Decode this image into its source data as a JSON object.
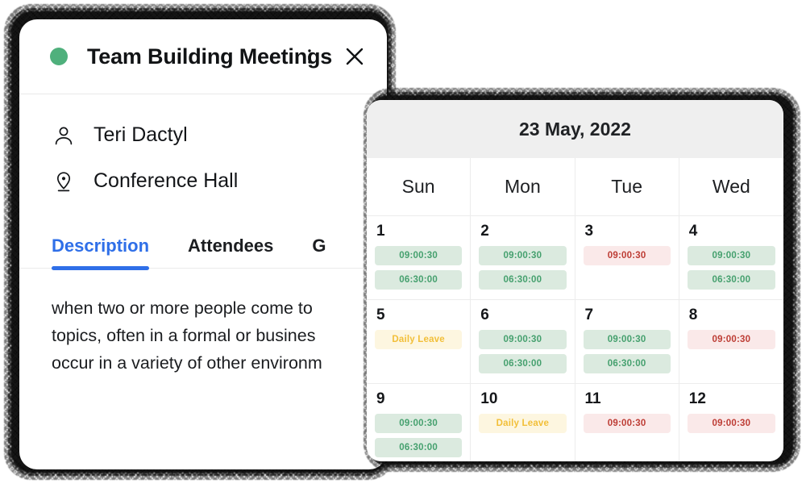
{
  "card": {
    "status_dot_color": "#4fb07c",
    "title": "Team Building Meetings",
    "menu_icon": "more-vertical-icon",
    "close_icon": "close-icon",
    "meta": [
      {
        "icon": "person-icon",
        "text": "Teri Dactyl"
      },
      {
        "icon": "location-pin-icon",
        "text": "Conference Hall"
      }
    ],
    "tabs": [
      {
        "label": "Description",
        "active": true
      },
      {
        "label": "Attendees",
        "active": false
      },
      {
        "label": "G",
        "active": false
      }
    ],
    "active_tab_color": "#2f6fe8",
    "description_lines": [
      "when two or more people come to",
      "topics, often in a formal or busines",
      "occur in a variety of other environm"
    ]
  },
  "calendar": {
    "title": "23 May, 2022",
    "header_bg": "#efefef",
    "weekdays": [
      "Sun",
      "Mon",
      "Tue",
      "Wed"
    ],
    "colors": {
      "green_bg": "#dbeadf",
      "green_text": "#45a06e",
      "red_bg": "#fae9e9",
      "red_text": "#bd3c34",
      "amber_bg": "#fdf6e0",
      "amber_text": "#f2bf38"
    },
    "days": [
      {
        "day": "1",
        "events": [
          {
            "label": "09:00:30",
            "tone": "green"
          },
          {
            "label": "06:30:00",
            "tone": "green"
          }
        ]
      },
      {
        "day": "2",
        "events": [
          {
            "label": "09:00:30",
            "tone": "green"
          },
          {
            "label": "06:30:00",
            "tone": "green"
          }
        ]
      },
      {
        "day": "3",
        "events": [
          {
            "label": "09:00:30",
            "tone": "red"
          }
        ]
      },
      {
        "day": "4",
        "events": [
          {
            "label": "09:00:30",
            "tone": "green"
          },
          {
            "label": "06:30:00",
            "tone": "green"
          }
        ]
      },
      {
        "day": "5",
        "events": [
          {
            "label": "Daily Leave",
            "tone": "amber"
          }
        ]
      },
      {
        "day": "6",
        "events": [
          {
            "label": "09:00:30",
            "tone": "green"
          },
          {
            "label": "06:30:00",
            "tone": "green"
          }
        ]
      },
      {
        "day": "7",
        "events": [
          {
            "label": "09:00:30",
            "tone": "green"
          },
          {
            "label": "06:30:00",
            "tone": "green"
          }
        ]
      },
      {
        "day": "8",
        "events": [
          {
            "label": "09:00:30",
            "tone": "red"
          }
        ]
      },
      {
        "day": "9",
        "events": [
          {
            "label": "09:00:30",
            "tone": "green"
          },
          {
            "label": "06:30:00",
            "tone": "green"
          }
        ]
      },
      {
        "day": "10",
        "events": [
          {
            "label": "Daily Leave",
            "tone": "amber"
          }
        ]
      },
      {
        "day": "11",
        "events": [
          {
            "label": "09:00:30",
            "tone": "red"
          }
        ]
      },
      {
        "day": "12",
        "events": [
          {
            "label": "09:00:30",
            "tone": "red"
          }
        ]
      }
    ]
  }
}
